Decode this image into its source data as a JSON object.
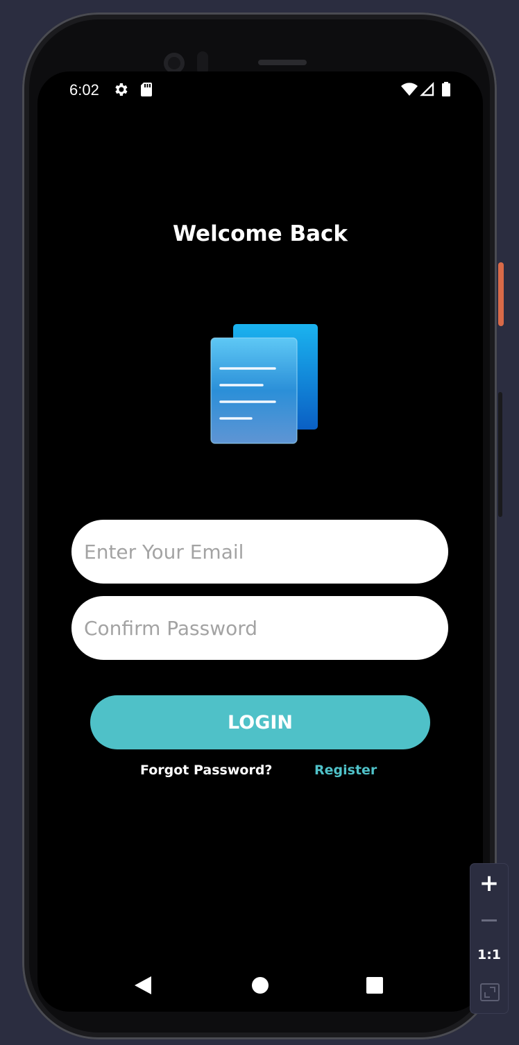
{
  "status_bar": {
    "time": "6:02",
    "icons": [
      "settings-gear-icon",
      "sd-card-icon",
      "wifi-icon",
      "cell-signal-icon",
      "battery-icon"
    ]
  },
  "login": {
    "title": "Welcome Back",
    "logo_icon": "documents-icon",
    "email_placeholder": "Enter Your Email",
    "password_placeholder": "Confirm Password",
    "login_button": "LOGIN",
    "forgot_password": "Forgot Password?",
    "register": "Register"
  },
  "nav_bar": {
    "icons": [
      "back-icon",
      "home-icon",
      "recents-icon"
    ]
  },
  "zoom_controls": {
    "zoom_in": "+",
    "ratio": "1:1"
  },
  "colors": {
    "accent": "#4fc1c8",
    "background": "#000000",
    "emulator_bg": "#2b2d40"
  }
}
